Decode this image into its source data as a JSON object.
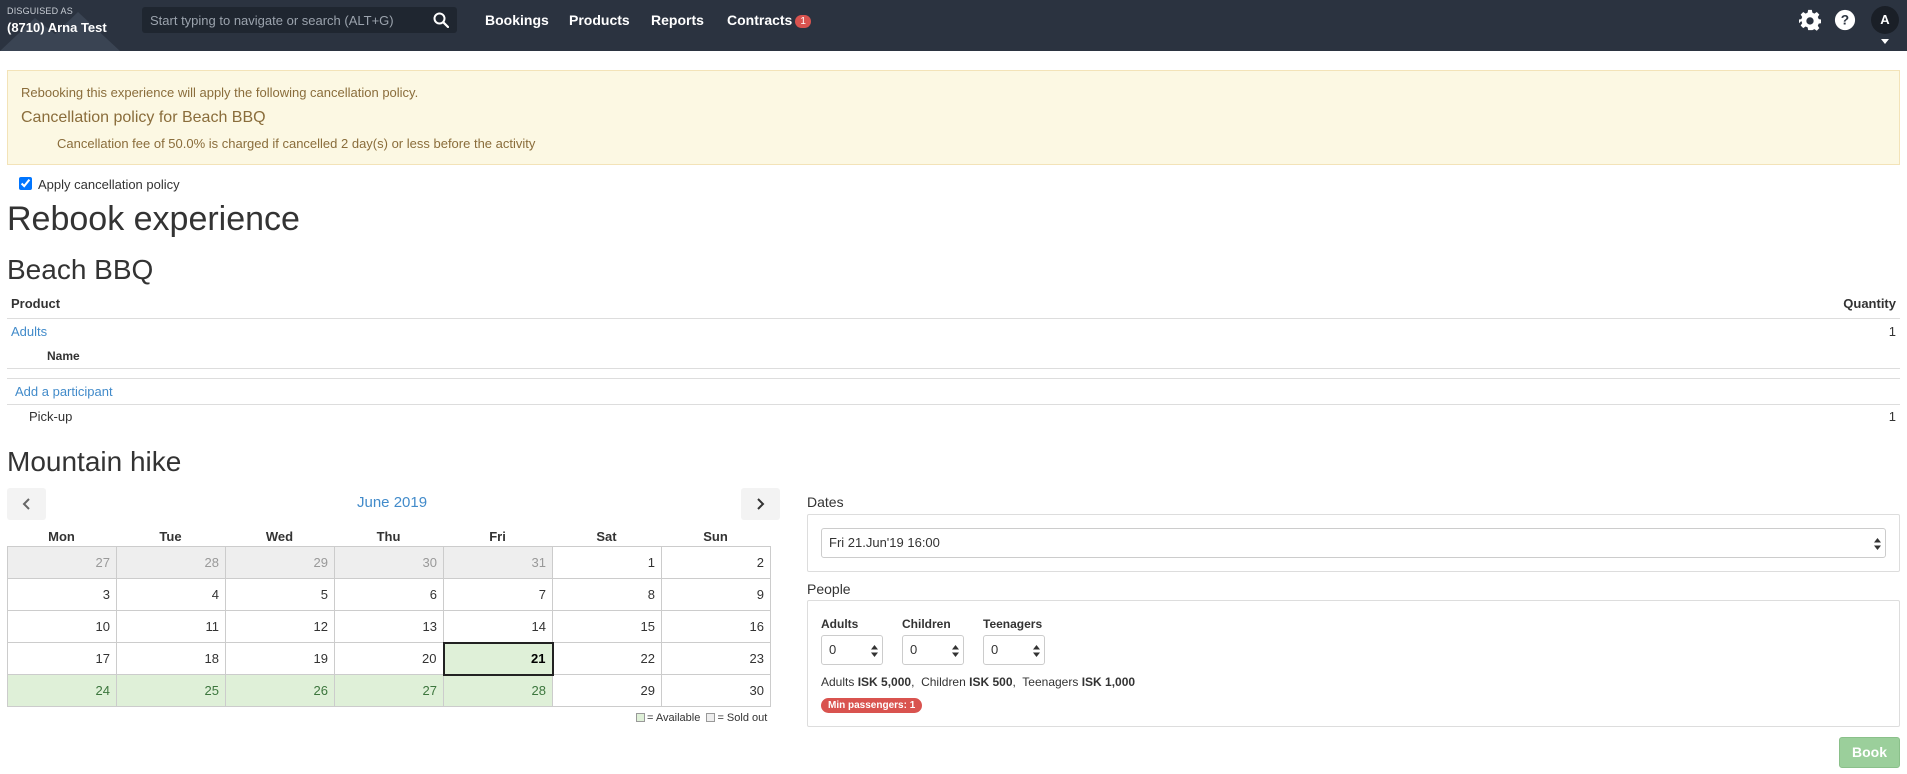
{
  "header": {
    "disguised_label": "DISGUISED AS",
    "account_name": "(8710) Arna Test",
    "search_placeholder": "Start typing to navigate or search (ALT+G)",
    "nav": {
      "bookings": "Bookings",
      "products": "Products",
      "reports": "Reports",
      "contracts": "Contracts",
      "contracts_badge": "1"
    },
    "icons": [
      "search-icon",
      "gear-icon",
      "help-icon",
      "chevron-down-icon"
    ],
    "avatar_initial": "A"
  },
  "alert": {
    "intro": "Rebooking this experience will apply the following cancellation policy.",
    "title": "Cancellation policy for Beach BBQ",
    "fee_text": "Cancellation fee of 50.0% is charged if cancelled 2 day(s) or less before the activity"
  },
  "apply_policy": {
    "label": "Apply cancellation policy",
    "checked": true
  },
  "page_title": "Rebook experience",
  "beach": {
    "title": "Beach BBQ",
    "col_product": "Product",
    "col_quantity": "Quantity",
    "row_adults": "Adults",
    "row_adults_qty": "1",
    "sub_name": "Name",
    "add_participant": "Add a participant",
    "pickup": "Pick-up",
    "pickup_qty": "1"
  },
  "mountain": {
    "title": "Mountain hike",
    "calendar": {
      "month": "June 2019",
      "days_of_week": [
        "Mon",
        "Tue",
        "Wed",
        "Thu",
        "Fri",
        "Sat",
        "Sun"
      ],
      "weeks": [
        [
          {
            "d": "27",
            "s": "other"
          },
          {
            "d": "28",
            "s": "other"
          },
          {
            "d": "29",
            "s": "other"
          },
          {
            "d": "30",
            "s": "other"
          },
          {
            "d": "31",
            "s": "other"
          },
          {
            "d": "1",
            "s": ""
          },
          {
            "d": "2",
            "s": ""
          }
        ],
        [
          {
            "d": "3",
            "s": ""
          },
          {
            "d": "4",
            "s": ""
          },
          {
            "d": "5",
            "s": ""
          },
          {
            "d": "6",
            "s": ""
          },
          {
            "d": "7",
            "s": ""
          },
          {
            "d": "8",
            "s": ""
          },
          {
            "d": "9",
            "s": ""
          }
        ],
        [
          {
            "d": "10",
            "s": ""
          },
          {
            "d": "11",
            "s": ""
          },
          {
            "d": "12",
            "s": ""
          },
          {
            "d": "13",
            "s": ""
          },
          {
            "d": "14",
            "s": ""
          },
          {
            "d": "15",
            "s": ""
          },
          {
            "d": "16",
            "s": ""
          }
        ],
        [
          {
            "d": "17",
            "s": ""
          },
          {
            "d": "18",
            "s": ""
          },
          {
            "d": "19",
            "s": ""
          },
          {
            "d": "20",
            "s": ""
          },
          {
            "d": "21",
            "s": "sel"
          },
          {
            "d": "22",
            "s": ""
          },
          {
            "d": "23",
            "s": ""
          }
        ],
        [
          {
            "d": "24",
            "s": "avail"
          },
          {
            "d": "25",
            "s": "avail"
          },
          {
            "d": "26",
            "s": "avail"
          },
          {
            "d": "27",
            "s": "avail"
          },
          {
            "d": "28",
            "s": "avail"
          },
          {
            "d": "29",
            "s": ""
          },
          {
            "d": "30",
            "s": ""
          }
        ]
      ],
      "legend_available": "= Available",
      "legend_soldout": "= Sold out"
    },
    "dates_label": "Dates",
    "selected_date": "Fri 21.Jun'19  16:00",
    "people_label": "People",
    "people": [
      {
        "label": "Adults",
        "value": "0"
      },
      {
        "label": "Children",
        "value": "0"
      },
      {
        "label": "Teenagers",
        "value": "0"
      }
    ],
    "prices": [
      {
        "label": "Adults",
        "price": "ISK 5,000"
      },
      {
        "label": "Children",
        "price": "ISK 500"
      },
      {
        "label": "Teenagers",
        "price": "ISK 1,000"
      }
    ],
    "min_passengers": "Min passengers: 1",
    "book_button": "Book"
  },
  "colors": {
    "topbar": "#2b3340",
    "alert_bg": "#fcf8e3",
    "link": "#428bca",
    "available": "#dff0d8",
    "danger": "#d9534f",
    "book": "#9bcf9b"
  }
}
